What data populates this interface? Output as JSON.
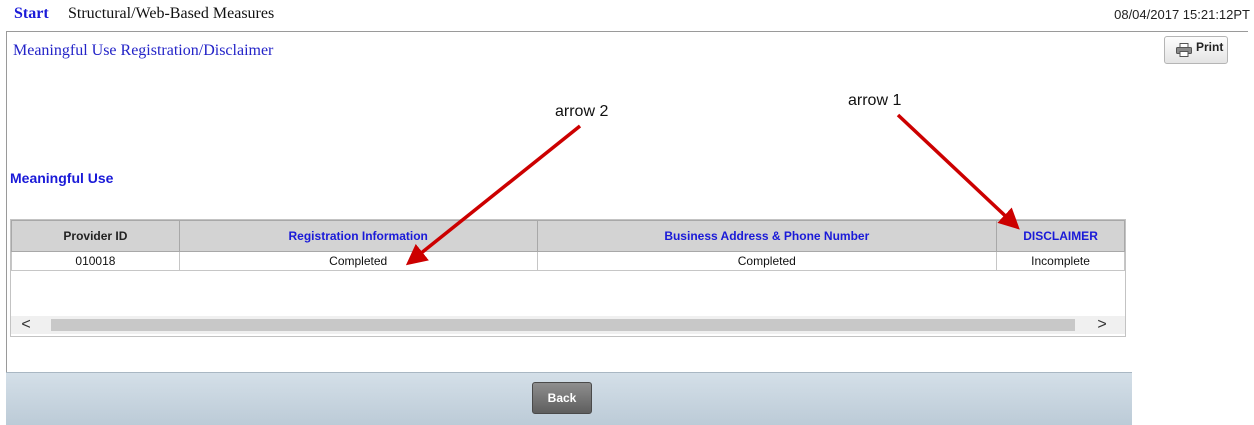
{
  "header": {
    "start_label": "Start",
    "breadcrumb": "Structural/Web-Based Measures",
    "datetime": "08/04/2017 15:21:12PT"
  },
  "panel": {
    "title": "Meaningful Use Registration/Disclaimer",
    "print_label": "Print",
    "print_icon": "printer-icon"
  },
  "section": {
    "label": "Meaningful Use"
  },
  "table": {
    "columns": [
      "Provider ID",
      "Registration Information",
      "Business Address & Phone Number",
      "DISCLAIMER"
    ],
    "rows": [
      [
        "010018",
        "Completed",
        "Completed",
        "Incomplete"
      ]
    ]
  },
  "scrollbar": {
    "left_arrow": "<",
    "right_arrow": ">"
  },
  "footer": {
    "back_label": "Back"
  },
  "annotations": {
    "arrow1_label": "arrow 1",
    "arrow2_label": "arrow 2",
    "arrow_color": "#cc0000"
  },
  "colors": {
    "link_blue": "#1a1ad8",
    "title_blue": "#2323c8",
    "header_gray": "#d3d3d3"
  }
}
